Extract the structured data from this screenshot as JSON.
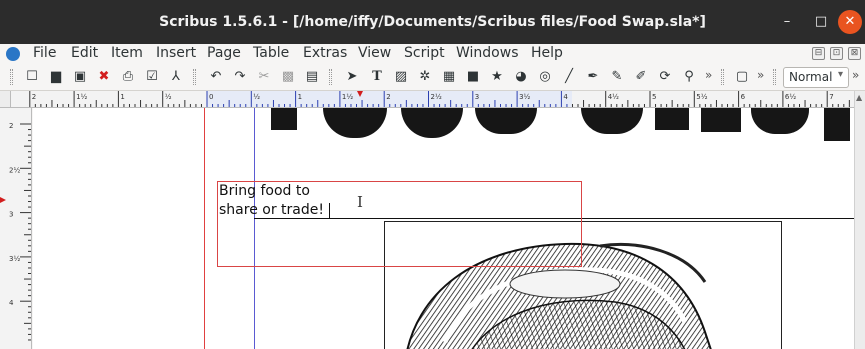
{
  "window": {
    "title": "Scribus 1.5.6.1 - [/home/iffy/Documents/Scribus files/Food Swap.sla*]",
    "minimize_glyph": "–",
    "maximize_glyph": "□",
    "close_glyph": "✕"
  },
  "menubar": {
    "items": [
      {
        "label": "File"
      },
      {
        "label": "Edit"
      },
      {
        "label": "Item"
      },
      {
        "label": "Insert"
      },
      {
        "label": "Page"
      },
      {
        "label": "Table"
      },
      {
        "label": "Extras"
      },
      {
        "label": "View"
      },
      {
        "label": "Script"
      },
      {
        "label": "Windows"
      },
      {
        "label": "Help"
      }
    ],
    "mdi_buttons": [
      "⊟",
      "⊡",
      "⊠"
    ]
  },
  "toolbar": {
    "more_glyph": "»",
    "mode_select": {
      "value": "Normal",
      "arrow": "▾"
    },
    "icons": [
      {
        "name": "new-document-icon",
        "glyph": "☐"
      },
      {
        "name": "open-document-icon",
        "glyph": "▆"
      },
      {
        "name": "save-icon",
        "glyph": "▣"
      },
      {
        "name": "close-document-icon",
        "glyph": "✖"
      },
      {
        "name": "print-icon",
        "glyph": "⎙"
      },
      {
        "name": "preflight-icon",
        "glyph": "☑"
      },
      {
        "name": "export-pdf-icon",
        "glyph": "⅄"
      },
      {
        "name": "undo-icon",
        "glyph": "↶"
      },
      {
        "name": "redo-icon",
        "glyph": "↷"
      },
      {
        "name": "cut-icon",
        "glyph": "✂"
      },
      {
        "name": "copy-icon",
        "glyph": "▩"
      },
      {
        "name": "paste-icon",
        "glyph": "▤"
      },
      {
        "name": "select-icon",
        "glyph": "➤"
      },
      {
        "name": "text-frame-icon",
        "glyph": "T"
      },
      {
        "name": "image-frame-icon",
        "glyph": "▨"
      },
      {
        "name": "render-frame-icon",
        "glyph": "✲"
      },
      {
        "name": "table-icon",
        "glyph": "▦"
      },
      {
        "name": "shape-icon",
        "glyph": "■"
      },
      {
        "name": "polygon-icon",
        "glyph": "★"
      },
      {
        "name": "arc-icon",
        "glyph": "◕"
      },
      {
        "name": "spiral-icon",
        "glyph": "◎"
      },
      {
        "name": "line-icon",
        "glyph": "╱"
      },
      {
        "name": "bezier-icon",
        "glyph": "✒"
      },
      {
        "name": "freehand-icon",
        "glyph": "✎"
      },
      {
        "name": "calligraphic-icon",
        "glyph": "✐"
      },
      {
        "name": "rotate-icon",
        "glyph": "⟳"
      },
      {
        "name": "zoom-icon",
        "glyph": "⚲"
      }
    ],
    "second_group_icon": {
      "name": "preview-mode-icon",
      "glyph": "▢"
    }
  },
  "rulers": {
    "horizontal_labels": [
      "2",
      "1½",
      "1",
      "½",
      "0",
      "½",
      "1",
      "1½",
      "2",
      "2½",
      "3",
      "3½",
      "4",
      "4½",
      "5",
      "5½",
      "6",
      "6½",
      "7"
    ],
    "vertical_labels": [
      "2",
      "2½",
      "3",
      "3½",
      "4"
    ]
  },
  "document": {
    "text_frame_content": "Bring food to\nshare or trade!"
  },
  "colors": {
    "titlebar": "#2c2c2c",
    "close_button": "#e95420",
    "text_frame_border": "#d94545",
    "guide_blue": "#5a5ad2"
  }
}
